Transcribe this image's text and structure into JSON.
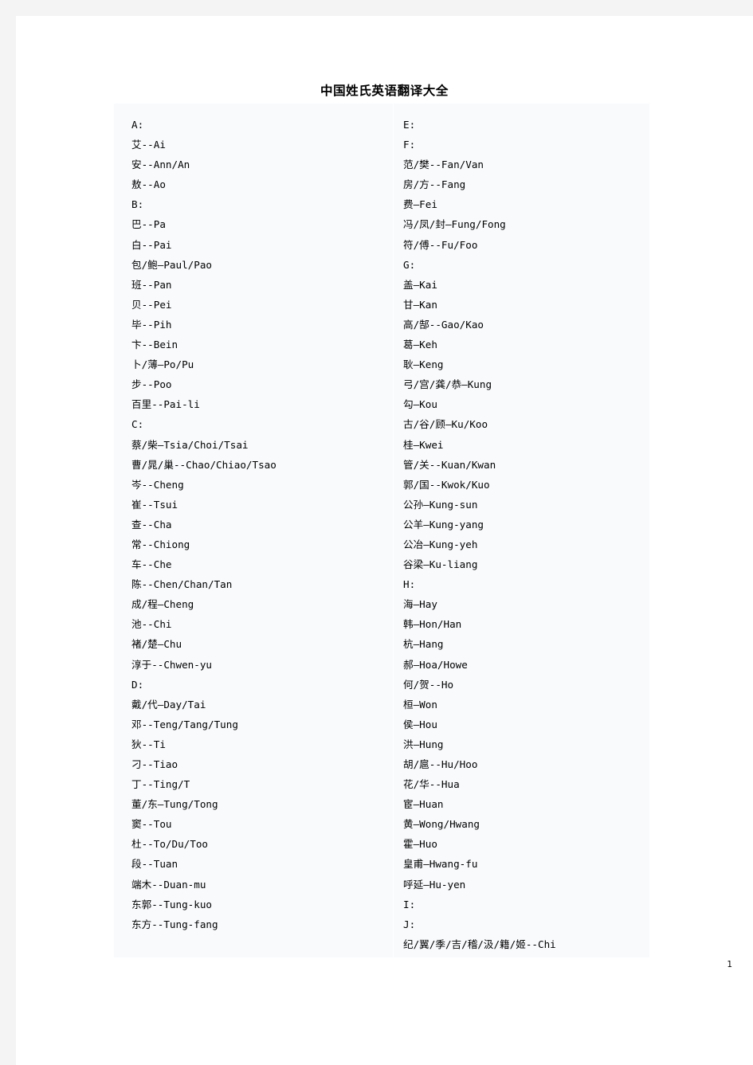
{
  "document": {
    "title": "中国姓氏英语翻译大全",
    "page_number": "1",
    "colors": {
      "page_background": "#ffffff",
      "outer_background": "#f4f4f5",
      "content_box_background": "#f8fafc",
      "text": "#000000"
    }
  },
  "left_column": [
    "A:",
    "艾--Ai",
    "安--Ann/An",
    "敖--Ao",
    "B:",
    "巴--Pa",
    "白--Pai",
    "包/鲍—Paul/Pao",
    "班--Pan",
    "贝--Pei",
    "毕--Pih",
    "卞--Bein",
    "卜/薄—Po/Pu",
    "步--Poo",
    "百里--Pai-li",
    "C:",
    "蔡/柴—Tsia/Choi/Tsai",
    "曹/晁/巢--Chao/Chiao/Tsao",
    "岑--Cheng",
    "崔--Tsui",
    "查--Cha",
    "常--Chiong",
    "车--Che",
    "陈--Chen/Chan/Tan",
    "成/程—Cheng",
    "池--Chi",
    "褚/楚—Chu",
    "淳于--Chwen-yu",
    "D:",
    "戴/代—Day/Tai",
    "邓--Teng/Tang/Tung",
    "狄--Ti",
    "刁--Tiao",
    "丁--Ting/T",
    "董/东—Tung/Tong",
    "窦--Tou",
    "杜--To/Du/Too",
    "段--Tuan",
    "端木--Duan-mu",
    "东郭--Tung-kuo",
    "东方--Tung-fang"
  ],
  "right_column": [
    "E:",
    "F:",
    "范/樊--Fan/Van",
    "房/方--Fang",
    "费—Fei",
    "冯/凤/封—Fung/Fong",
    "符/傅--Fu/Foo",
    "G:",
    "盖—Kai",
    "甘—Kan",
    "高/郜--Gao/Kao",
    "葛—Keh",
    "耿—Keng",
    "弓/宫/龚/恭—Kung",
    "勾—Kou",
    "古/谷/顾—Ku/Koo",
    "桂—Kwei",
    "管/关--Kuan/Kwan",
    "郭/国--Kwok/Kuo",
    "公孙—Kung-sun",
    "公羊—Kung-yang",
    "公冶—Kung-yeh",
    "谷梁—Ku-liang",
    "H:",
    "海—Hay",
    "韩—Hon/Han",
    "杭—Hang",
    "郝—Hoa/Howe",
    "何/贺--Ho",
    "桓—Won",
    "侯—Hou",
    "洪—Hung",
    "胡/扈--Hu/Hoo",
    "花/华--Hua",
    "宦—Huan",
    "黄—Wong/Hwang",
    "霍—Huo",
    "皇甫—Hwang-fu",
    "呼延—Hu-yen",
    "I:",
    "J:",
    "纪/翼/季/吉/稽/汲/籍/姬--Chi"
  ]
}
